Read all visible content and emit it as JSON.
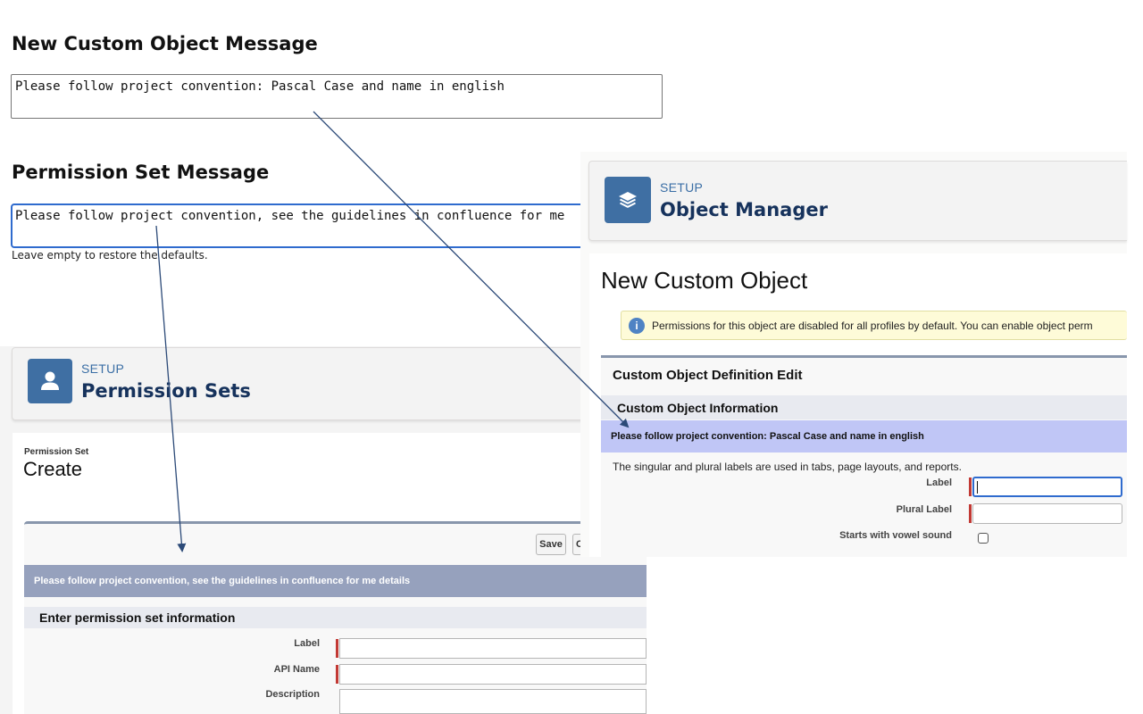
{
  "settings": {
    "custom_object_heading": "New Custom Object Message",
    "custom_object_value": "Please follow project convention: Pascal Case and name in english",
    "permission_set_heading": "Permission Set Message",
    "permission_set_value": "Please follow project convention, see the guidelines in confluence for me",
    "hint": "Leave empty to restore the defaults."
  },
  "permission_sets": {
    "eyebrow": "SETUP",
    "title": "Permission Sets",
    "page_label": "Permission Set",
    "page_title": "Create",
    "save_button": "Save",
    "cancel_button_partial": "C",
    "message": "Please follow project convention, see the guidelines in confluence for me details",
    "section_title": "Enter permission set information",
    "fields": {
      "label": "Label",
      "api_name": "API Name",
      "description": "Description"
    }
  },
  "object_manager": {
    "eyebrow": "SETUP",
    "title": "Object Manager",
    "page_title": "New Custom Object",
    "info_text": "Permissions for this object are disabled for all profiles by default. You can enable object perm",
    "info_icon": "info-icon",
    "section_title": "Custom Object Definition Edit",
    "subsection_title": "Custom Object Information",
    "message": "Please follow project convention: Pascal Case and name in english",
    "help_text": "The singular and plural labels are used in tabs, page layouts, and reports.",
    "fields": {
      "label": "Label",
      "plural_label": "Plural Label",
      "vowel": "Starts with vowel sound"
    }
  },
  "colors": {
    "accent_blue": "#2f6bce",
    "setup_icon": "#3f6fa3",
    "arrow": "#2c4a78",
    "ps_message_bg": "#96a1bd",
    "om_message_bg": "#c0c6f6",
    "required": "#c23934"
  }
}
